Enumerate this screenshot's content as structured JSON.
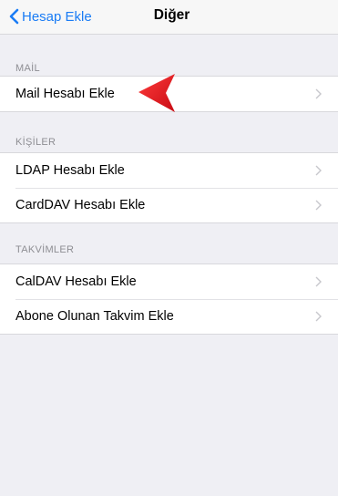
{
  "nav": {
    "back_label": "Hesap Ekle",
    "title": "Diğer"
  },
  "sections": [
    {
      "header": "MAİL",
      "items": [
        "Mail Hesabı Ekle"
      ]
    },
    {
      "header": "KİŞİLER",
      "items": [
        "LDAP Hesabı Ekle",
        "CardDAV Hesabı Ekle"
      ]
    },
    {
      "header": "TAKVİMLER",
      "items": [
        "CalDAV Hesabı Ekle",
        "Abone Olunan Takvim Ekle"
      ]
    }
  ],
  "icons": {
    "back": "chevron-left-icon",
    "disclosure": "chevron-right-icon",
    "annotation": "red-arrow-pointer"
  },
  "colors": {
    "accent": "#1a7cf5",
    "background": "#efeff4",
    "annotation": "#e3141c"
  }
}
